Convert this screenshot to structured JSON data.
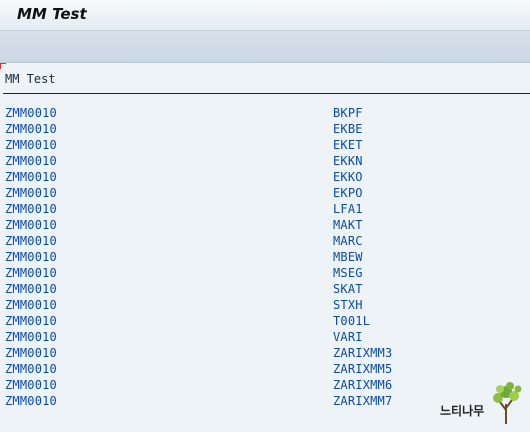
{
  "window": {
    "title": "MM Test"
  },
  "list": {
    "header": "MM Test",
    "rows": [
      {
        "program": "ZMM0010",
        "table": "BKPF"
      },
      {
        "program": "ZMM0010",
        "table": "EKBE"
      },
      {
        "program": "ZMM0010",
        "table": "EKET"
      },
      {
        "program": "ZMM0010",
        "table": "EKKN"
      },
      {
        "program": "ZMM0010",
        "table": "EKKO"
      },
      {
        "program": "ZMM0010",
        "table": "EKPO"
      },
      {
        "program": "ZMM0010",
        "table": "LFA1"
      },
      {
        "program": "ZMM0010",
        "table": "MAKT"
      },
      {
        "program": "ZMM0010",
        "table": "MARC"
      },
      {
        "program": "ZMM0010",
        "table": "MBEW"
      },
      {
        "program": "ZMM0010",
        "table": "MSEG"
      },
      {
        "program": "ZMM0010",
        "table": "SKAT"
      },
      {
        "program": "ZMM0010",
        "table": "STXH"
      },
      {
        "program": "ZMM0010",
        "table": "T001L"
      },
      {
        "program": "ZMM0010",
        "table": "VARI"
      },
      {
        "program": "ZMM0010",
        "table": "ZARIXMM3"
      },
      {
        "program": "ZMM0010",
        "table": "ZARIXMM5"
      },
      {
        "program": "ZMM0010",
        "table": "ZARIXMM6"
      },
      {
        "program": "ZMM0010",
        "table": "ZARIXMM7"
      }
    ]
  },
  "watermark": {
    "text": "느티나무"
  },
  "colors": {
    "list_text": "#0c4aa6",
    "background": "#eef3f7",
    "marker": "#d23a3a"
  }
}
